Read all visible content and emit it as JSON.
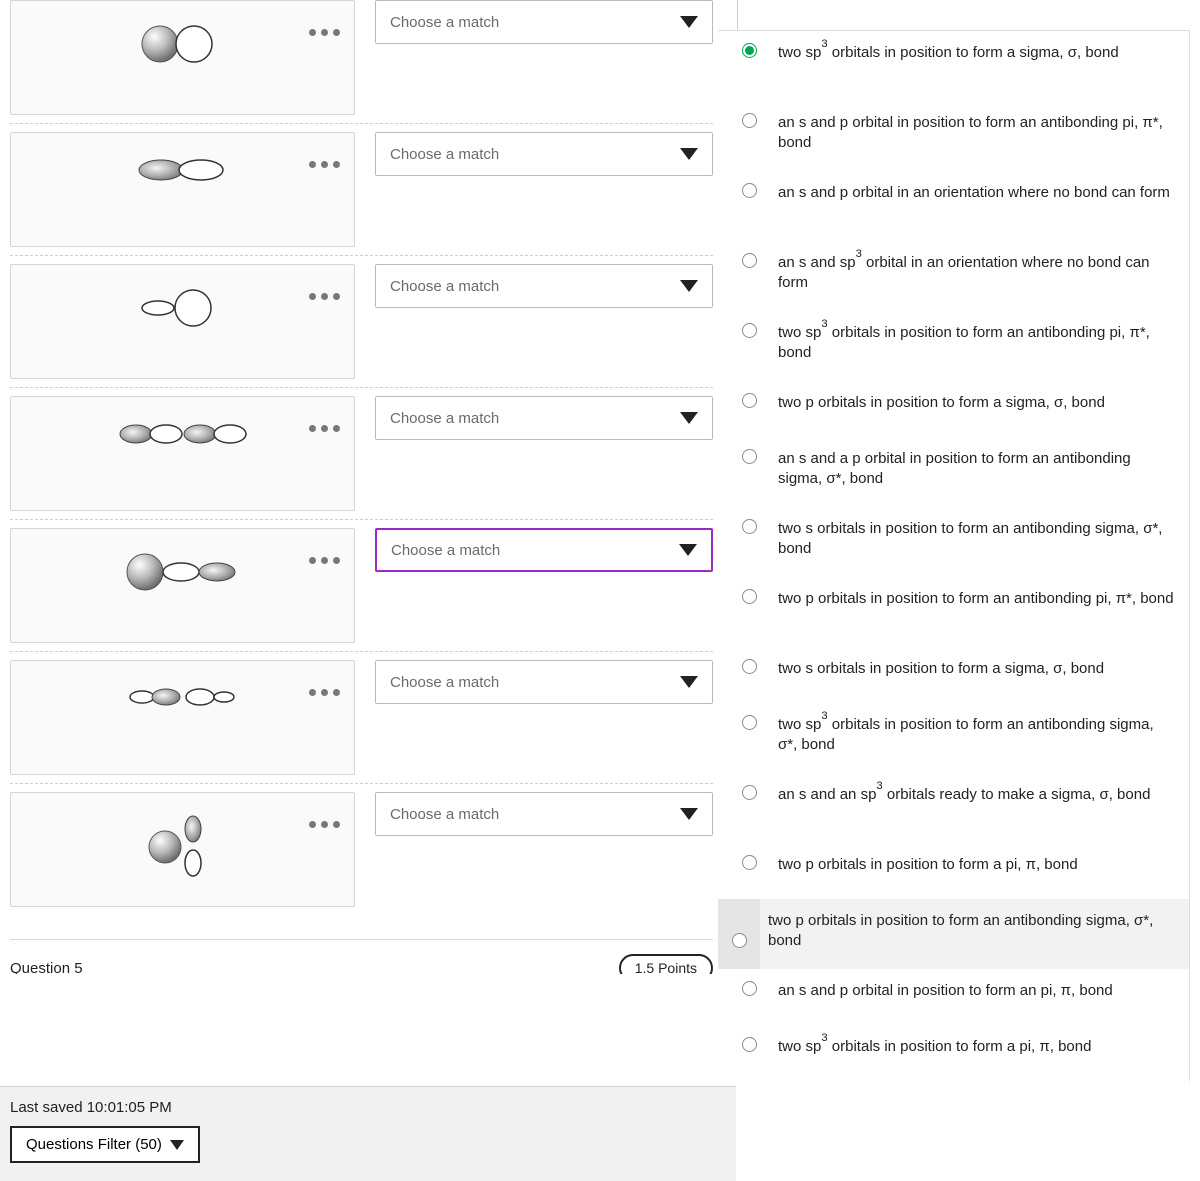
{
  "dropdown_placeholder": "Choose a match",
  "next_question_label": "Question 5",
  "next_question_points": "1.5 Points",
  "last_saved_label": "Last saved",
  "last_saved_time": "10:01:05 PM",
  "filter_button_label": "Questions Filter (50)",
  "options": [
    {
      "html": "two sp<sup>3</sup> orbitals in position to form a sigma, σ, bond",
      "selected": true,
      "tall": true
    },
    {
      "html": "an s and p orbital in position to form an antibonding pi, π*, bond",
      "tall": true
    },
    {
      "html": "an s and p orbital in an orientation where no bond can form",
      "tall": true
    },
    {
      "html": "an s and sp<sup>3</sup> orbital in an orientation where no bond can form",
      "tall": true
    },
    {
      "html": "two sp<sup>3</sup> orbitals in position to form an antibonding pi, π*, bond",
      "tall": true
    },
    {
      "html": "two p orbitals in position to form a sigma, σ, bond"
    },
    {
      "html": "an s and a p orbital in position to form an antibonding sigma, σ*, bond",
      "tall": true
    },
    {
      "html": "two s orbitals in position to form an antibonding sigma, σ*, bond",
      "tall": true
    },
    {
      "html": "two p orbitals in position to form an antibonding pi, π*, bond",
      "tall": true
    },
    {
      "html": "two s orbitals in position to form a sigma, σ, bond"
    },
    {
      "html": "two sp<sup>3</sup> orbitals in position to form an antibonding sigma, σ*, bond",
      "tall": true
    },
    {
      "html": "an s and an sp<sup>3</sup> orbitals ready to make a sigma, σ, bond",
      "tall": true
    },
    {
      "html": "two p orbitals in position to form a pi, π, bond"
    },
    {
      "html": "two p orbitals in position to form an antibonding sigma, σ*, bond",
      "hover": true,
      "tall": true
    },
    {
      "html": "an s and p orbital in position to form an pi, π, bond"
    },
    {
      "html": "two sp<sup>3</sup> orbitals in position to form a pi, π, bond"
    }
  ],
  "match_rows": [
    {
      "orbital_kind": "sphere-pair",
      "focused": false
    },
    {
      "orbital_kind": "two-lobes-touching",
      "focused": false
    },
    {
      "orbital_kind": "lobe-sphere",
      "focused": false
    },
    {
      "orbital_kind": "two-dumbbells",
      "focused": false
    },
    {
      "orbital_kind": "sphere-dumbbell",
      "focused": true
    },
    {
      "orbital_kind": "dumbbell-lobe-apart",
      "focused": false
    },
    {
      "orbital_kind": "sphere-vertical-dumbbell",
      "focused": false
    }
  ]
}
